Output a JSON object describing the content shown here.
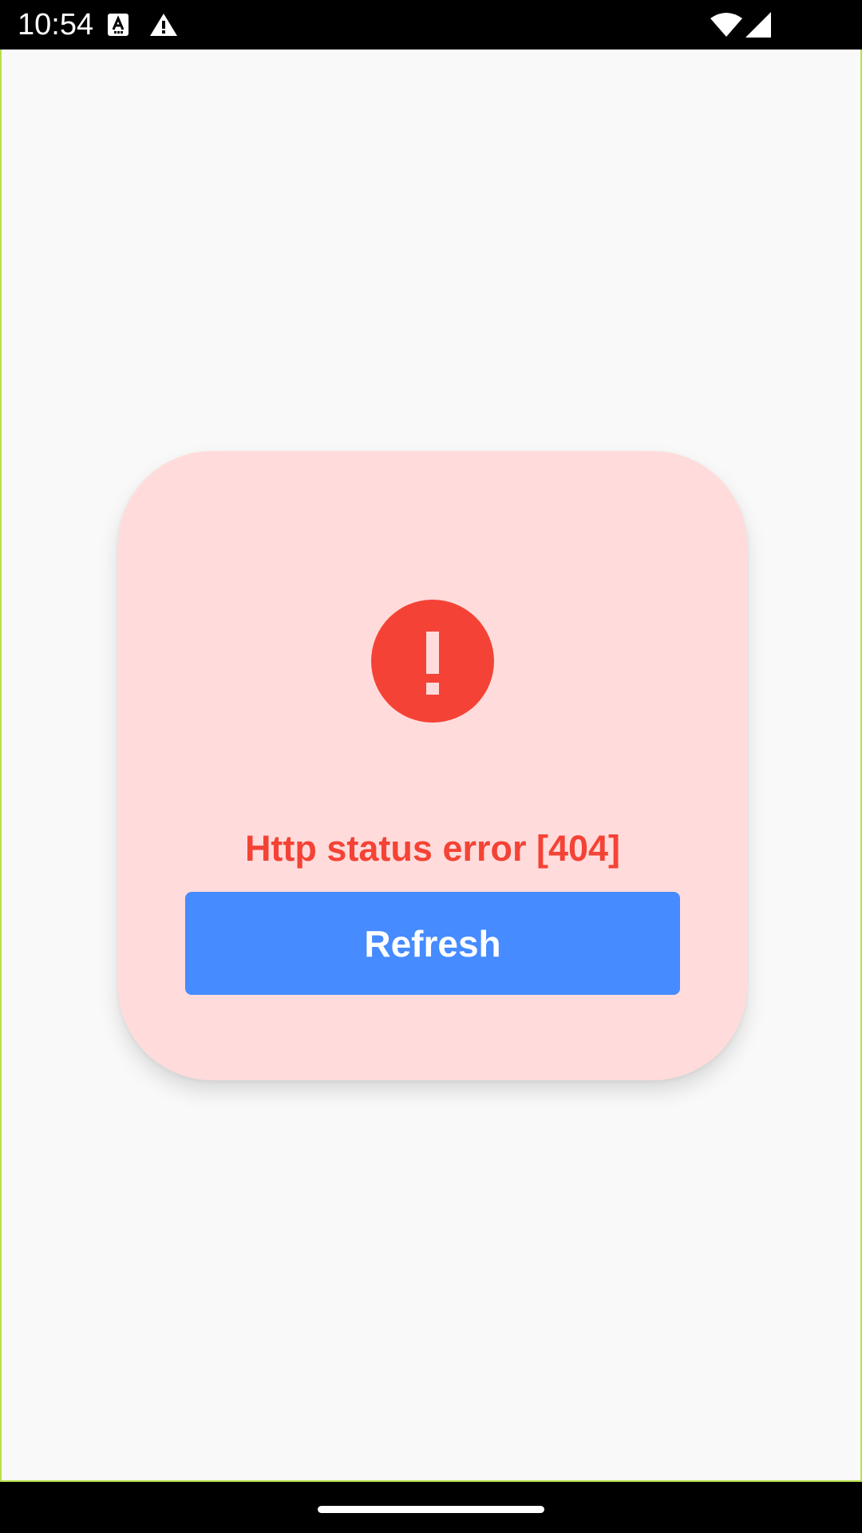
{
  "status_bar": {
    "time": "10:54",
    "left_icons": [
      "a-notification-icon",
      "warning-notification-icon"
    ],
    "right_icons": [
      "wifi-icon",
      "cellular-signal-icon"
    ]
  },
  "error_card": {
    "icon": "error-icon",
    "message": "Http status error [404]",
    "refresh_label": "Refresh"
  },
  "colors": {
    "card_background": "#ffdcdb",
    "error_red": "#f44336",
    "button_blue": "#468bff",
    "app_background": "#f9f9f9",
    "frame_outline": "#b7e04a"
  },
  "nav_bar": {
    "home_indicator": "home-handle"
  }
}
